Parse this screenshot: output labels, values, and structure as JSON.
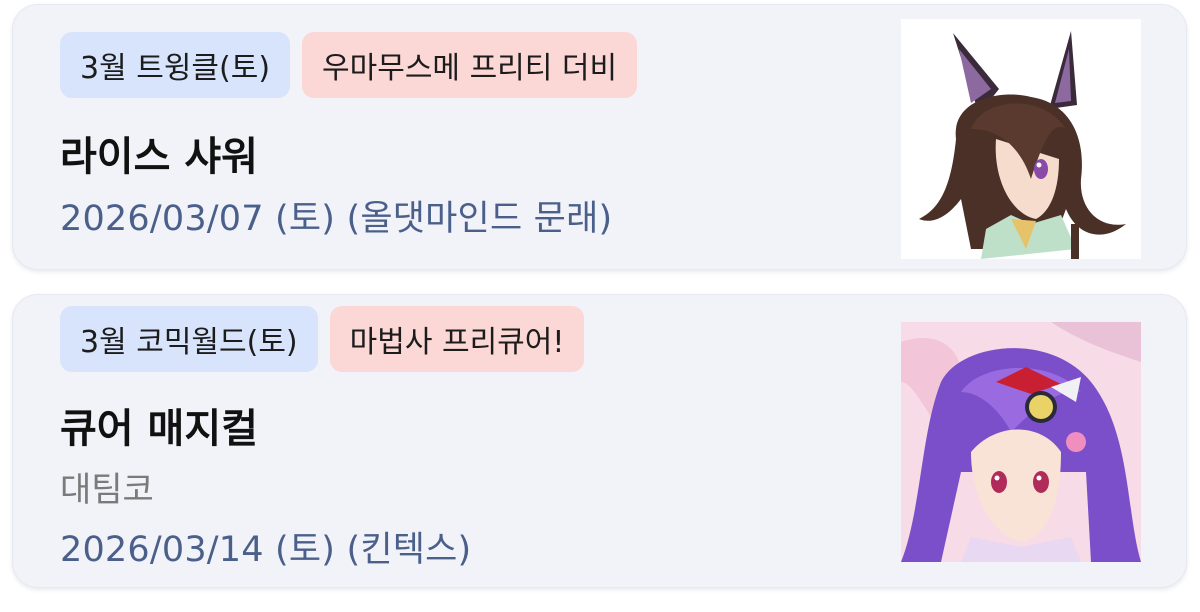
{
  "cards": [
    {
      "tag_event": "3월 트윙클(토)",
      "tag_series": "우마무스메 프리티 더비",
      "title": "라이스 샤워",
      "date_line": "2026/03/07 (토) (올댓마인드 문래)",
      "thumbnail_icon": "character-portrait-icon"
    },
    {
      "tag_event": "3월 코믹월드(토)",
      "tag_series": "마법사 프리큐어!",
      "title": "큐어 매지컬",
      "subtitle": "대팀코",
      "date_line": "2026/03/14 (토) (킨텍스)",
      "thumbnail_icon": "character-portrait-icon"
    }
  ],
  "colors": {
    "card_bg": "#f2f3f9",
    "tag_blue": "#d7e4fb",
    "tag_red": "#fbd7d6",
    "date_text": "#4a5f8a"
  }
}
